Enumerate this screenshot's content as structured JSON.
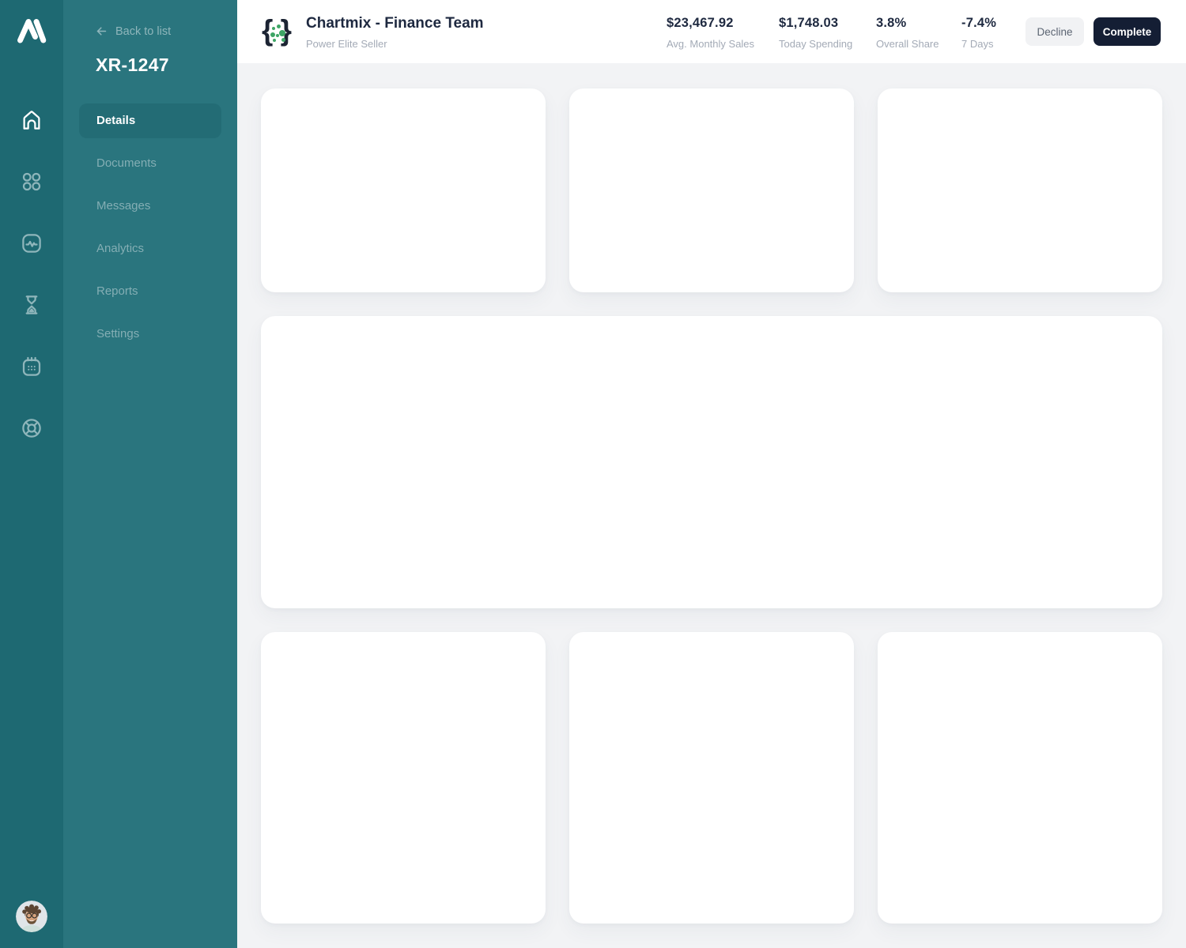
{
  "colors": {
    "rail_bg": "#1E6972",
    "sidebar_bg": "#2A757E",
    "active_item_bg": "#236C75",
    "content_bg": "#F2F3F5",
    "card_bg": "#FFFFFF",
    "accent_green": "#3EA566",
    "complete_button_bg": "#141E34",
    "heading_navy": "#1E2940",
    "muted_gray": "#A3AAB6"
  },
  "rail": {
    "icons": [
      "home-icon",
      "grid-icon",
      "activity-icon",
      "hourglass-icon",
      "calendar-icon",
      "life-ring-icon"
    ],
    "active_icon": "home-icon"
  },
  "sidebar": {
    "back_label": "Back to list",
    "title": "XR-1247",
    "items": [
      {
        "label": "Details",
        "active": true
      },
      {
        "label": "Documents",
        "active": false
      },
      {
        "label": "Messages",
        "active": false
      },
      {
        "label": "Analytics",
        "active": false
      },
      {
        "label": "Reports",
        "active": false
      },
      {
        "label": "Settings",
        "active": false
      }
    ]
  },
  "header": {
    "title": "Chartmix - Finance Team",
    "subtitle": "Power Elite Seller",
    "stats": [
      {
        "value": "$23,467.92",
        "label": "Avg. Monthly Sales"
      },
      {
        "value": "$1,748.03",
        "label": "Today Spending"
      },
      {
        "value": "3.8%",
        "label": "Overall Share"
      },
      {
        "value": "-7.4%",
        "label": "7 Days"
      }
    ],
    "decline_label": "Decline",
    "complete_label": "Complete"
  },
  "content": {
    "cards": [
      "top-card-1",
      "top-card-2",
      "top-card-3",
      "wide-card",
      "bottom-card-1",
      "bottom-card-2",
      "bottom-card-3"
    ]
  }
}
